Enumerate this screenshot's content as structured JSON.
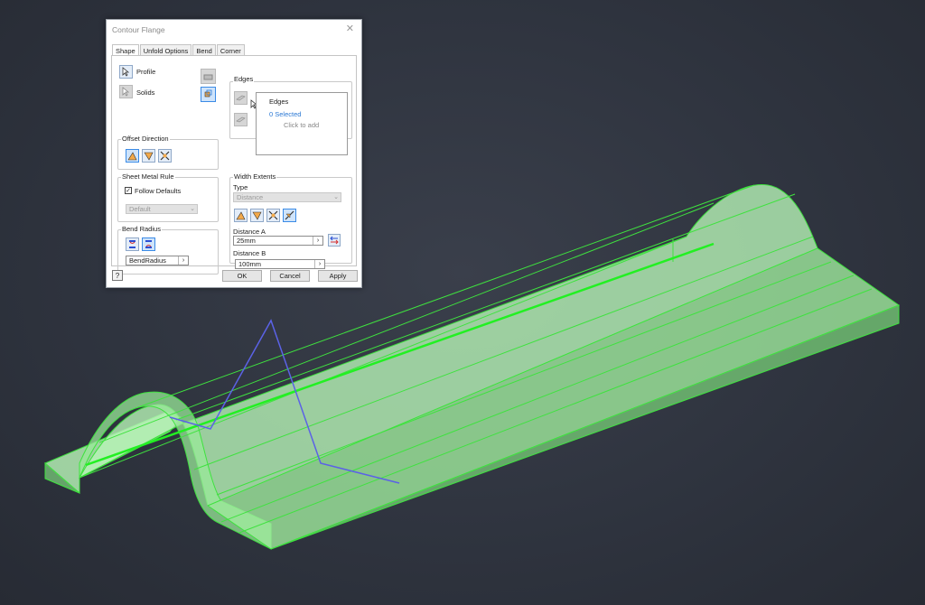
{
  "dialog": {
    "title": "Contour Flange",
    "close": "✕",
    "tabs": [
      "Shape",
      "Unfold Options",
      "Bend",
      "Corner"
    ],
    "shape": {
      "profile_label": "Profile",
      "solids_label": "Solids",
      "offset_direction_label": "Offset Direction",
      "sheet_metal_rule_label": "Sheet Metal Rule",
      "follow_defaults_label": "Follow Defaults",
      "follow_defaults_checked": "✓",
      "rule_value": "Default",
      "bend_radius_label": "Bend Radius",
      "bend_radius_value": "BendRadius",
      "edges_group_label": "Edges",
      "edges_box_title": "Edges",
      "edges_selected": "0 Selected",
      "edges_hint": "Click to add",
      "width_extents_label": "Width Extents",
      "type_label": "Type",
      "type_value": "Distance",
      "distance_a_label": "Distance A",
      "distance_a_value": "25mm",
      "distance_b_label": "Distance B",
      "distance_b_value": "100mm",
      "arrow_glyph": "›"
    },
    "help": "?",
    "buttons": {
      "ok": "OK",
      "cancel": "Cancel",
      "apply": "Apply"
    }
  },
  "colors": {
    "background": "#2f343f",
    "part_fill": "#a6f2a6",
    "part_edge": "#3fe23f",
    "sketch_line": "#5b62e6",
    "annotation_arrow": "#e03030",
    "accent_blue": "#2a78d4"
  }
}
